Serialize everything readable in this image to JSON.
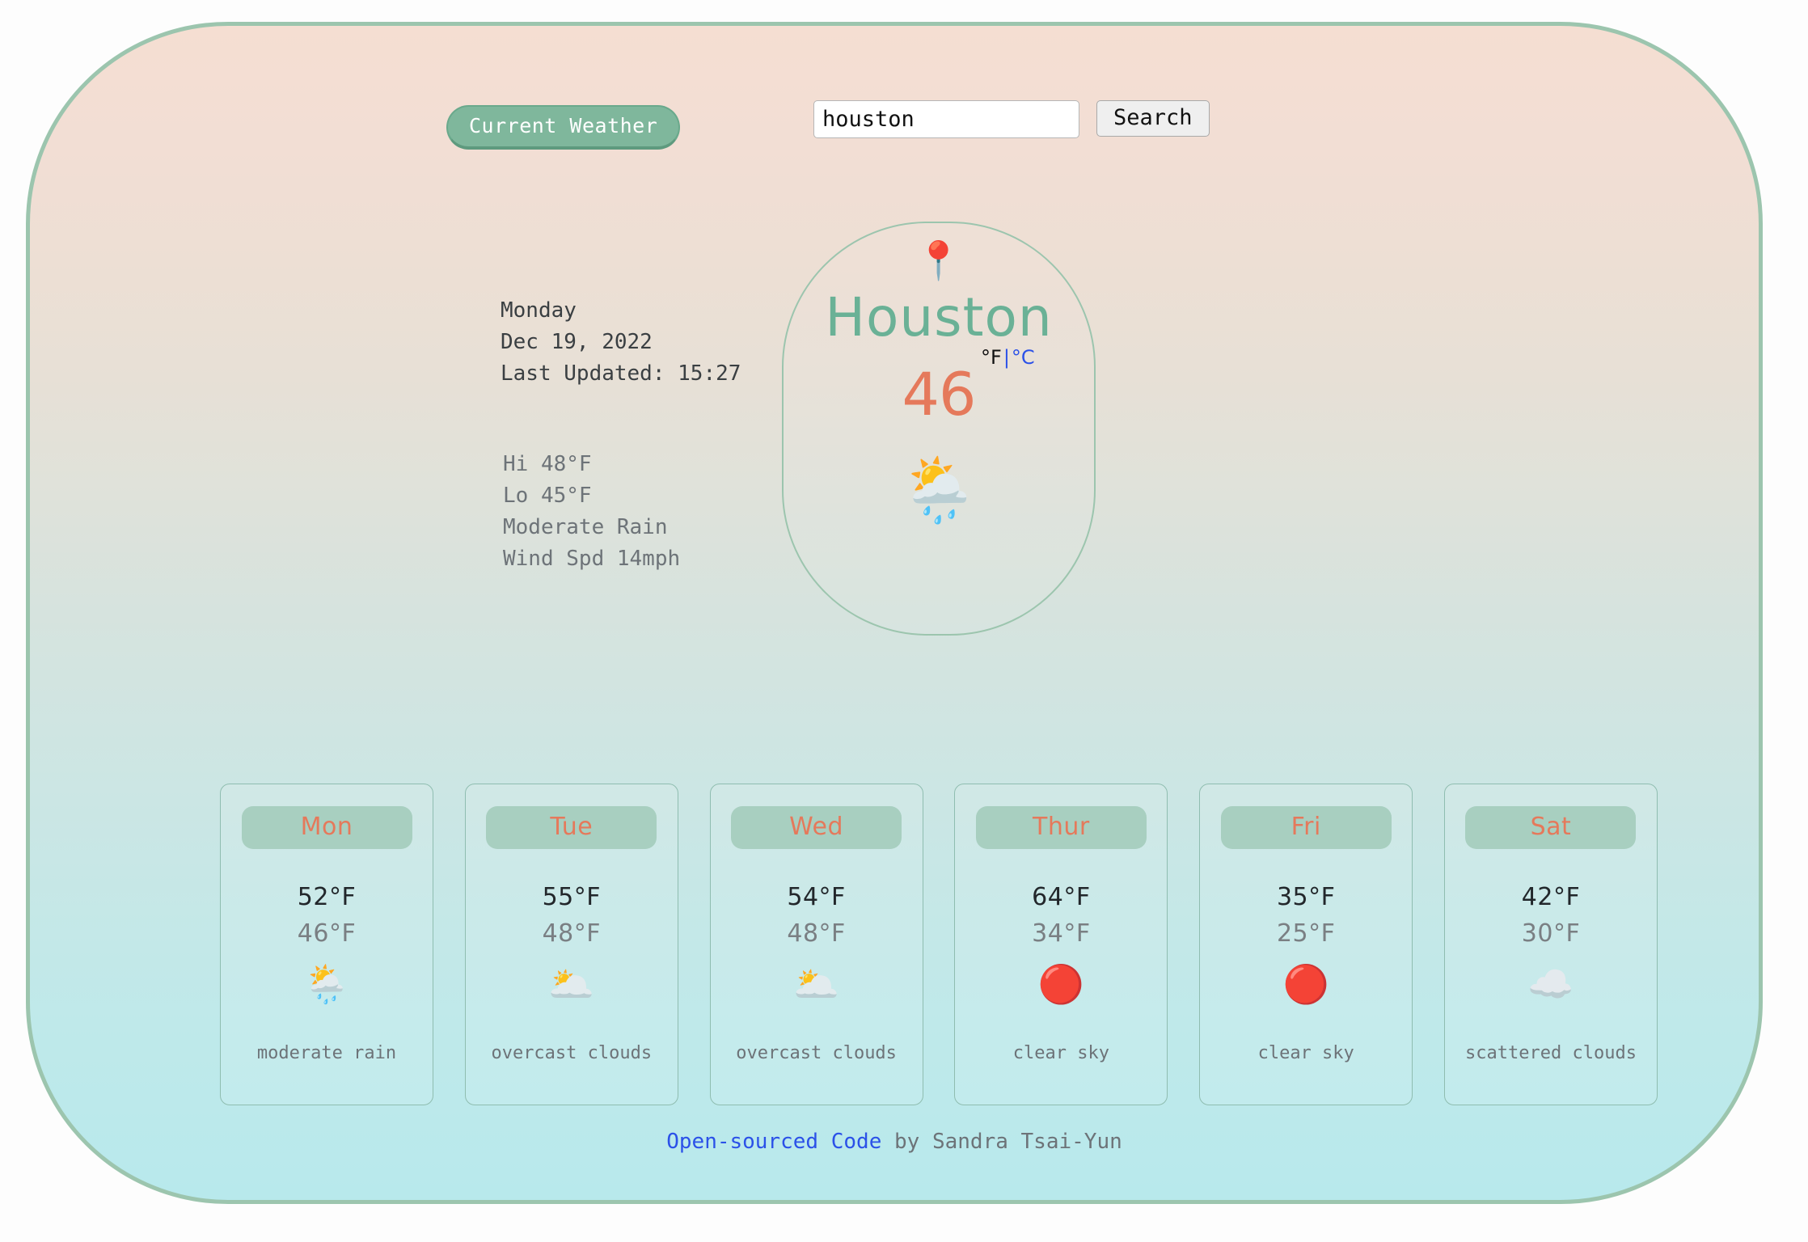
{
  "nav": {
    "current_weather_label": "Current Weather"
  },
  "search": {
    "value": "houston",
    "placeholder": "",
    "button_label": "Search"
  },
  "current": {
    "weekday": "Monday",
    "date": "Dec 19, 2022",
    "last_updated": "Last Updated: 15:27",
    "hi": "Hi 48°F",
    "lo": "Lo 45°F",
    "condition": "Moderate Rain",
    "wind": "Wind Spd 14mph",
    "pin_icon": "📍",
    "city": "Houston",
    "temperature": "46",
    "unit_active": "°F",
    "unit_separator": "|",
    "unit_link": "°C",
    "weather_icon": "🌦️"
  },
  "forecast": [
    {
      "day": "Mon",
      "hi": "52°F",
      "lo": "46°F",
      "icon": "🌦️",
      "description": "moderate rain"
    },
    {
      "day": "Tue",
      "hi": "55°F",
      "lo": "48°F",
      "icon": "🌥️",
      "description": "overcast clouds"
    },
    {
      "day": "Wed",
      "hi": "54°F",
      "lo": "48°F",
      "icon": "🌥️",
      "description": "overcast clouds"
    },
    {
      "day": "Thur",
      "hi": "64°F",
      "lo": "34°F",
      "icon": "🔴",
      "description": "clear sky"
    },
    {
      "day": "Fri",
      "hi": "35°F",
      "lo": "25°F",
      "icon": "🔴",
      "description": "clear sky"
    },
    {
      "day": "Sat",
      "hi": "42°F",
      "lo": "30°F",
      "icon": "☁️",
      "description": "scattered clouds"
    }
  ],
  "footer": {
    "link_text": "Open-sourced Code",
    "author_text": " by Sandra Tsai-Yun"
  },
  "colors": {
    "accent_green": "#7fb79c",
    "accent_orange": "#e5795b",
    "city_teal": "#6ab196",
    "link_blue": "#2b51e8",
    "border_green": "#9cc5ae"
  }
}
